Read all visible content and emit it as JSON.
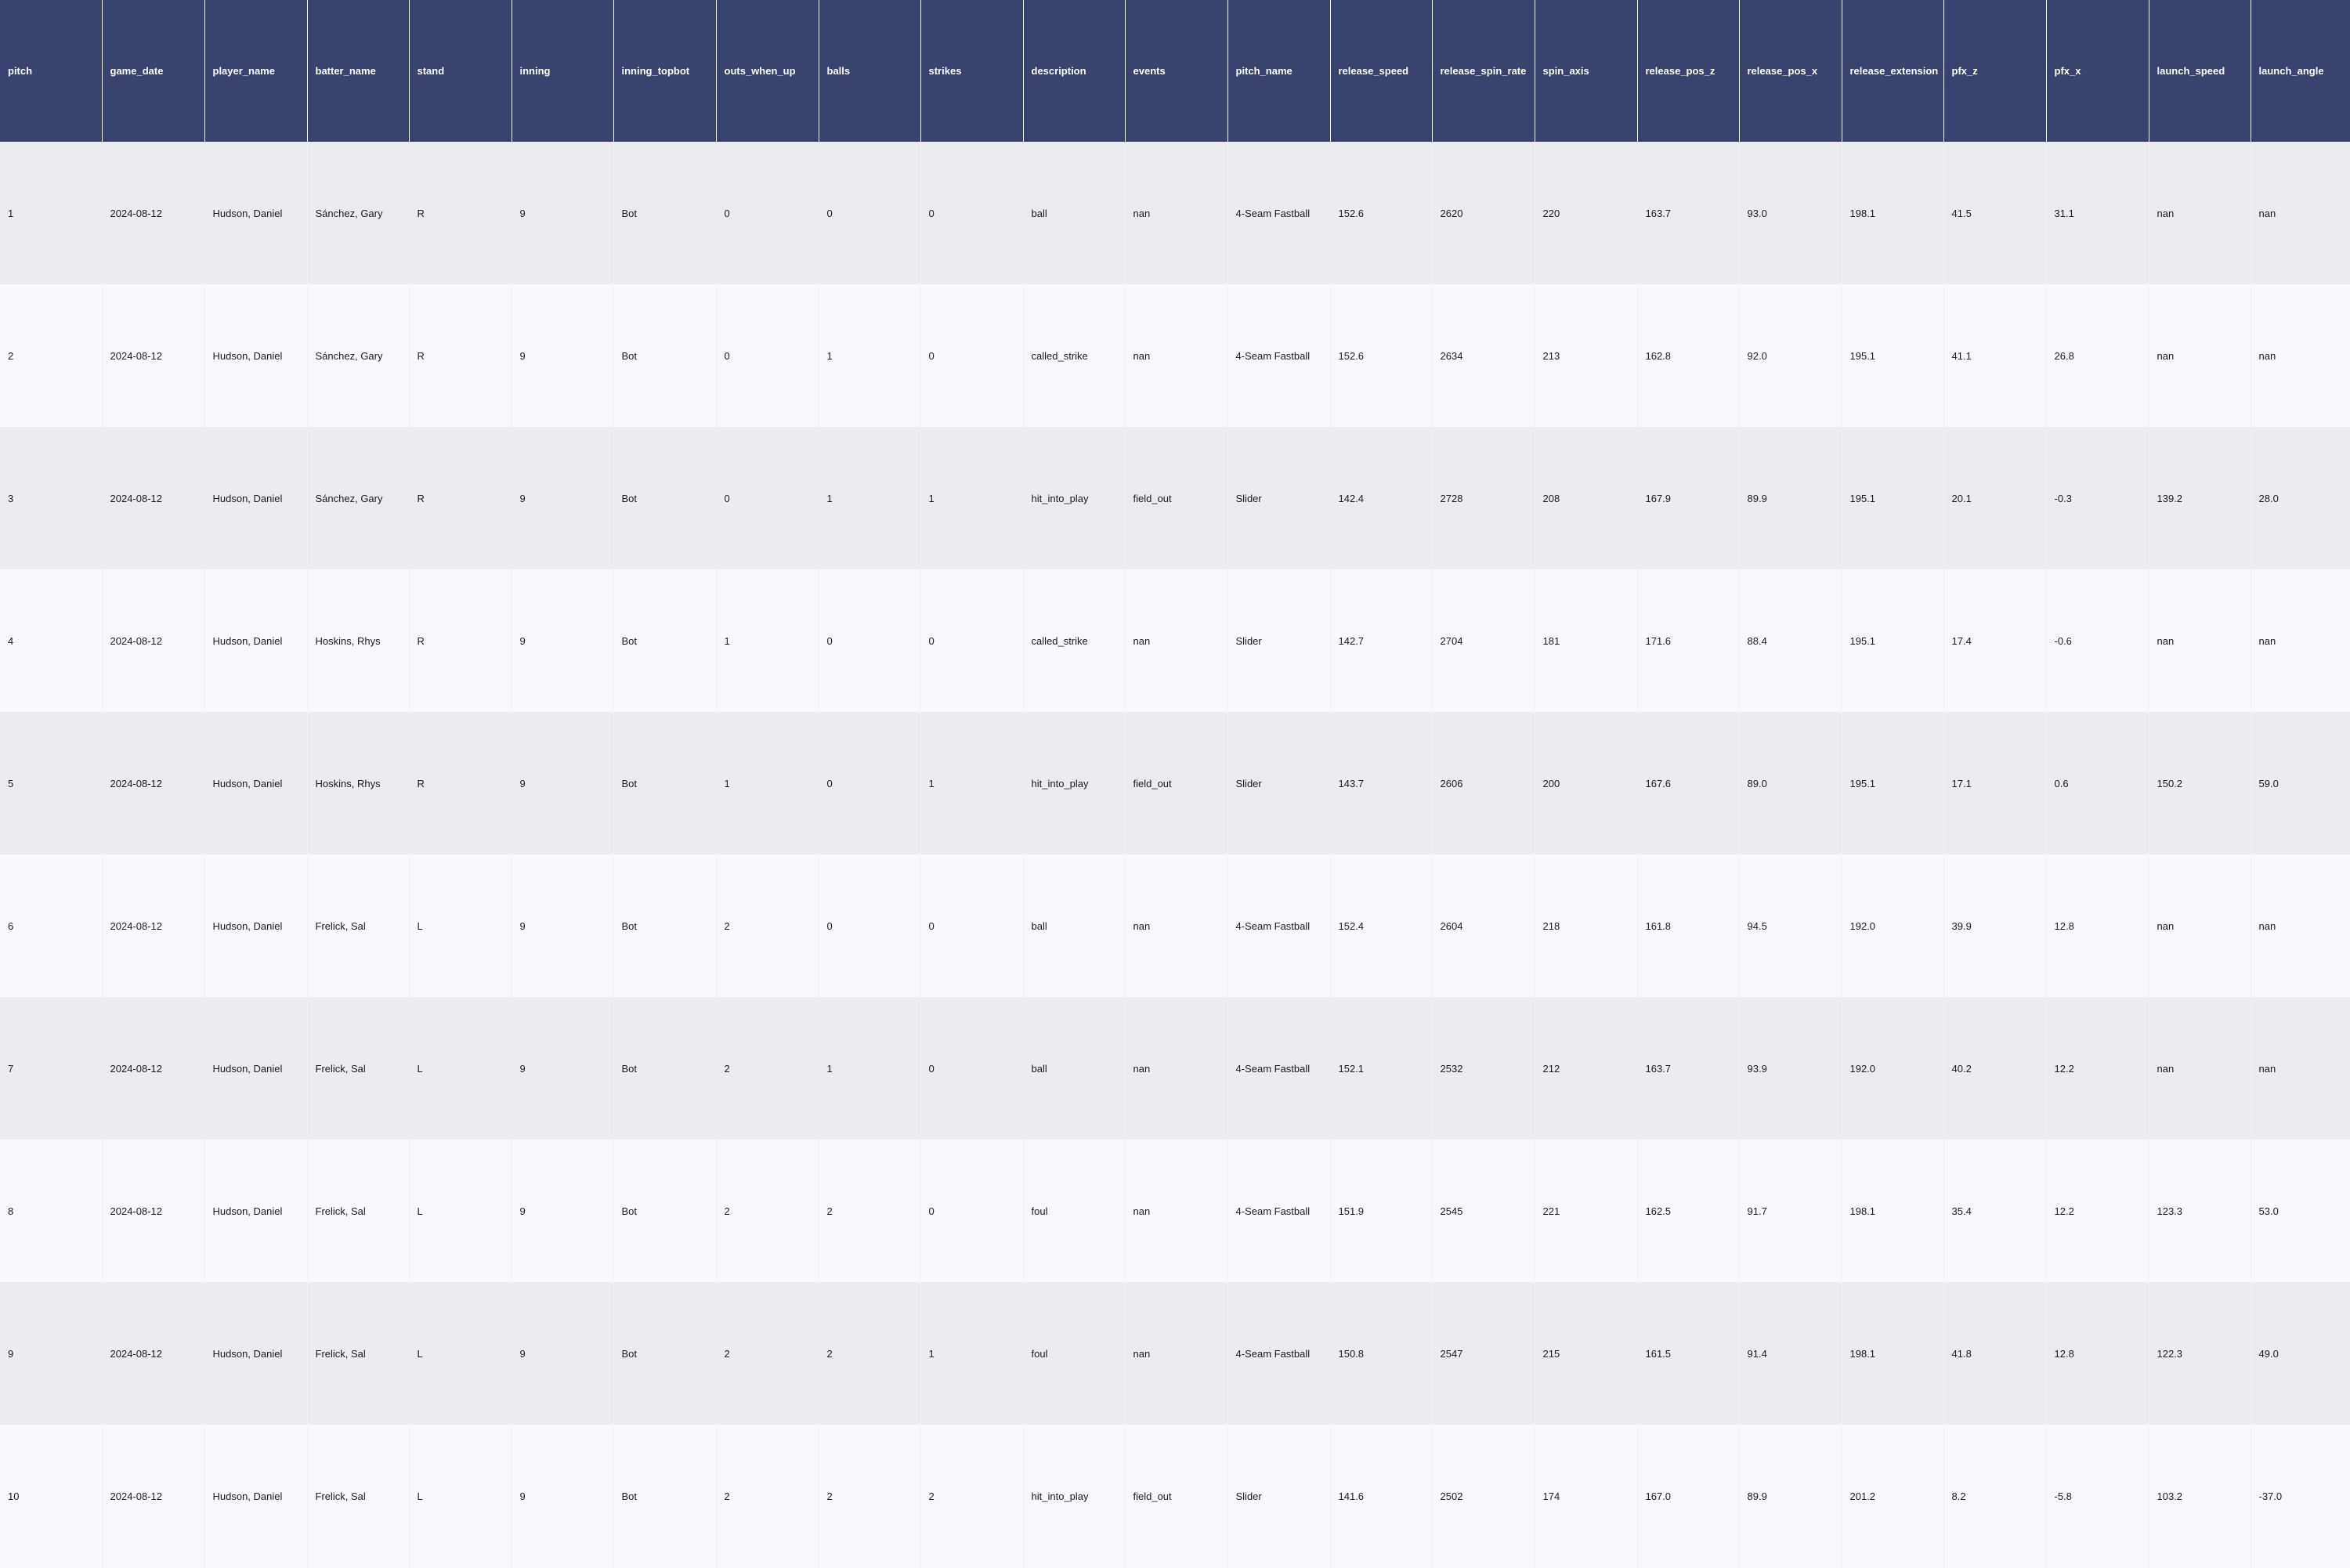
{
  "colors": {
    "header_bg": "#3a4270",
    "header_text": "#ffffff",
    "row_odd_bg": "#ebecf0",
    "row_even_bg": "#f7f9fc",
    "cell_text": "#1a1a1a"
  },
  "table": {
    "columns": [
      "pitch",
      "game_date",
      "player_name",
      "batter_name",
      "stand",
      "inning",
      "inning_topbot",
      "outs_when_up",
      "balls",
      "strikes",
      "description",
      "events",
      "pitch_name",
      "release_speed",
      "release_spin_rate",
      "spin_axis",
      "release_pos_z",
      "release_pos_x",
      "release_extension",
      "pfx_z",
      "pfx_x",
      "launch_speed",
      "launch_angle"
    ],
    "rows": [
      [
        "1",
        "2024-08-12",
        "Hudson, Daniel",
        "Sánchez, Gary",
        "R",
        "9",
        "Bot",
        "0",
        "0",
        "0",
        "ball",
        "nan",
        "4-Seam Fastball",
        "152.6",
        "2620",
        "220",
        "163.7",
        "93.0",
        "198.1",
        "41.5",
        "31.1",
        "nan",
        "nan"
      ],
      [
        "2",
        "2024-08-12",
        "Hudson, Daniel",
        "Sánchez, Gary",
        "R",
        "9",
        "Bot",
        "0",
        "1",
        "0",
        "called_strike",
        "nan",
        "4-Seam Fastball",
        "152.6",
        "2634",
        "213",
        "162.8",
        "92.0",
        "195.1",
        "41.1",
        "26.8",
        "nan",
        "nan"
      ],
      [
        "3",
        "2024-08-12",
        "Hudson, Daniel",
        "Sánchez, Gary",
        "R",
        "9",
        "Bot",
        "0",
        "1",
        "1",
        "hit_into_play",
        "field_out",
        "Slider",
        "142.4",
        "2728",
        "208",
        "167.9",
        "89.9",
        "195.1",
        "20.1",
        "-0.3",
        "139.2",
        "28.0"
      ],
      [
        "4",
        "2024-08-12",
        "Hudson, Daniel",
        "Hoskins, Rhys",
        "R",
        "9",
        "Bot",
        "1",
        "0",
        "0",
        "called_strike",
        "nan",
        "Slider",
        "142.7",
        "2704",
        "181",
        "171.6",
        "88.4",
        "195.1",
        "17.4",
        "-0.6",
        "nan",
        "nan"
      ],
      [
        "5",
        "2024-08-12",
        "Hudson, Daniel",
        "Hoskins, Rhys",
        "R",
        "9",
        "Bot",
        "1",
        "0",
        "1",
        "hit_into_play",
        "field_out",
        "Slider",
        "143.7",
        "2606",
        "200",
        "167.6",
        "89.0",
        "195.1",
        "17.1",
        "0.6",
        "150.2",
        "59.0"
      ],
      [
        "6",
        "2024-08-12",
        "Hudson, Daniel",
        "Frelick, Sal",
        "L",
        "9",
        "Bot",
        "2",
        "0",
        "0",
        "ball",
        "nan",
        "4-Seam Fastball",
        "152.4",
        "2604",
        "218",
        "161.8",
        "94.5",
        "192.0",
        "39.9",
        "12.8",
        "nan",
        "nan"
      ],
      [
        "7",
        "2024-08-12",
        "Hudson, Daniel",
        "Frelick, Sal",
        "L",
        "9",
        "Bot",
        "2",
        "1",
        "0",
        "ball",
        "nan",
        "4-Seam Fastball",
        "152.1",
        "2532",
        "212",
        "163.7",
        "93.9",
        "192.0",
        "40.2",
        "12.2",
        "nan",
        "nan"
      ],
      [
        "8",
        "2024-08-12",
        "Hudson, Daniel",
        "Frelick, Sal",
        "L",
        "9",
        "Bot",
        "2",
        "2",
        "0",
        "foul",
        "nan",
        "4-Seam Fastball",
        "151.9",
        "2545",
        "221",
        "162.5",
        "91.7",
        "198.1",
        "35.4",
        "12.2",
        "123.3",
        "53.0"
      ],
      [
        "9",
        "2024-08-12",
        "Hudson, Daniel",
        "Frelick, Sal",
        "L",
        "9",
        "Bot",
        "2",
        "2",
        "1",
        "foul",
        "nan",
        "4-Seam Fastball",
        "150.8",
        "2547",
        "215",
        "161.5",
        "91.4",
        "198.1",
        "41.8",
        "12.8",
        "122.3",
        "49.0"
      ],
      [
        "10",
        "2024-08-12",
        "Hudson, Daniel",
        "Frelick, Sal",
        "L",
        "9",
        "Bot",
        "2",
        "2",
        "2",
        "hit_into_play",
        "field_out",
        "Slider",
        "141.6",
        "2502",
        "174",
        "167.0",
        "89.9",
        "201.2",
        "8.2",
        "-5.8",
        "103.2",
        "-37.0"
      ]
    ]
  }
}
